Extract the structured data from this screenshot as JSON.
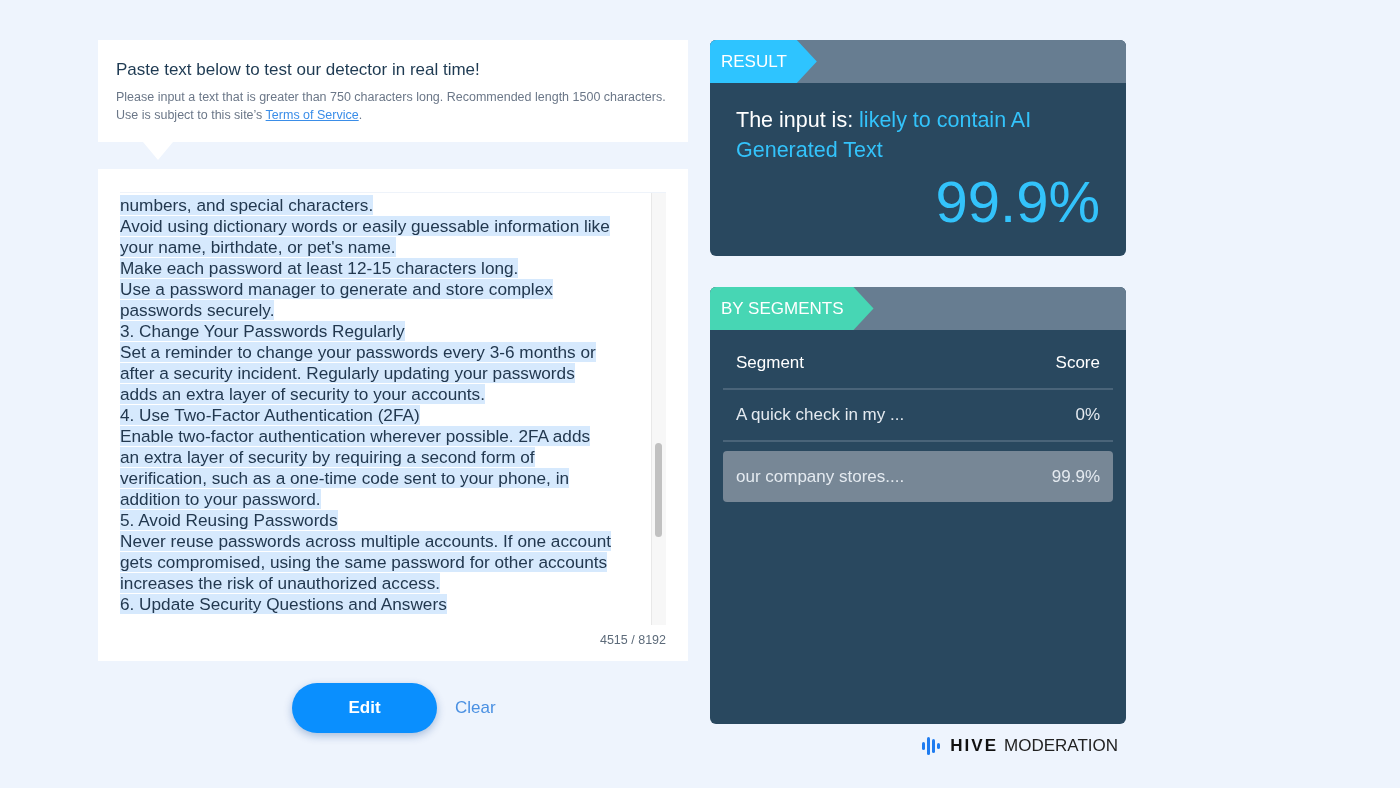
{
  "intro": {
    "title": "Paste text below to test our detector in real time!",
    "description": "Please input a text that is greater than 750 characters long. Recommended length 1500 characters. Use is subject to this site’s",
    "link": "Terms of Service",
    "after_link": "."
  },
  "editor": {
    "highlighted": true,
    "lines": [
      "numbers, and special characters.",
      "Avoid using dictionary words or easily guessable information like",
      "your name, birthdate, or pet's name.",
      "Make each password at least 12-15 characters long.",
      "Use a password manager to generate and store complex",
      "passwords securely.",
      "3. Change Your Passwords Regularly",
      "Set a reminder to change your passwords every 3-6 months or",
      "after a security incident. Regularly updating your passwords",
      "adds an extra layer of security to your accounts.",
      "4. Use Two-Factor Authentication (2FA)",
      "Enable two-factor authentication wherever possible. 2FA adds",
      "an extra layer of security by requiring a second form of",
      "verification, such as a one-time code sent to your phone, in",
      "addition to your password.",
      "5. Avoid Reusing Passwords",
      "Never reuse passwords across multiple accounts. If one account",
      "gets compromised, using the same password for other accounts",
      "increases the risk of unauthorized access.",
      "6. Update Security Questions and Answers"
    ],
    "counter": "4515 / 8192"
  },
  "buttons": {
    "edit": "Edit",
    "clear": "Clear"
  },
  "result": {
    "tag": "RESULT",
    "prefix": "The input is:",
    "verdict": "likely to contain AI Generated Text",
    "score": "99.9%"
  },
  "segments": {
    "tag": "BY SEGMENTS",
    "columns": [
      "Segment",
      "Score"
    ],
    "rows": [
      {
        "segment": "A quick check in my ...",
        "score": "0%",
        "selected": false
      },
      {
        "segment": "our company stores....",
        "score": "99.9%",
        "selected": true
      }
    ]
  },
  "brand": {
    "name": "HIVE",
    "suffix": "MODERATION"
  }
}
